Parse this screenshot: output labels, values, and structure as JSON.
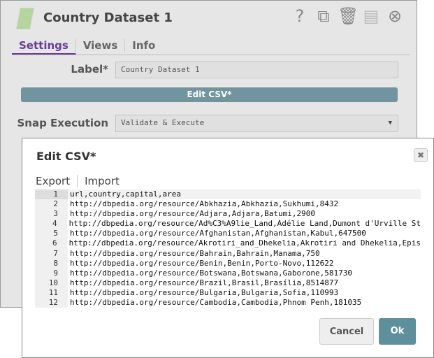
{
  "snap": {
    "title": "Country Dataset 1",
    "icons": [
      "help-icon",
      "export-icon",
      "delete-icon",
      "save-icon",
      "close-icon"
    ],
    "tabs": [
      "Settings",
      "Views",
      "Info"
    ],
    "label_caption": "Label*",
    "label_value": "Country Dataset 1",
    "edit_csv_label": "Edit CSV*",
    "execution_caption": "Snap Execution",
    "execution_value": "Validate & Execute"
  },
  "modal": {
    "title": "Edit CSV*",
    "export_label": "Export",
    "import_label": "Import",
    "lines": [
      {
        "n": "1",
        "text": "url,country,capital,area"
      },
      {
        "n": "2",
        "text": "http://dbpedia.org/resource/Abkhazia,Abkhazia,Sukhumi,8432"
      },
      {
        "n": "3",
        "text": "http://dbpedia.org/resource/Adjara,Adjara,Batumi,2900"
      },
      {
        "n": "4",
        "text": "http://dbpedia.org/resource/Ad%C3%A9lie_Land,Adélie Land,Dumont d'Urville St"
      },
      {
        "n": "5",
        "text": "http://dbpedia.org/resource/Afghanistan,Afghanistan,Kabul,647500"
      },
      {
        "n": "6",
        "text": "http://dbpedia.org/resource/Akrotiri_and_Dhekelia,Akrotiri and Dhekelia,Epis"
      },
      {
        "n": "7",
        "text": "http://dbpedia.org/resource/Bahrain,Bahrain,Manama,750"
      },
      {
        "n": "8",
        "text": "http://dbpedia.org/resource/Benin,Benin,Porto-Novo,112622"
      },
      {
        "n": "9",
        "text": "http://dbpedia.org/resource/Botswana,Botswana,Gaborone,581730"
      },
      {
        "n": "10",
        "text": "http://dbpedia.org/resource/Brazil,Brasil,Brasília,8514877"
      },
      {
        "n": "11",
        "text": "http://dbpedia.org/resource/Bulgaria,Bulgaria,Sofia,110993"
      },
      {
        "n": "12",
        "text": "http://dbpedia.org/resource/Cambodia,Cambodia,Phnom Penh,181035"
      }
    ],
    "cancel_label": "Cancel",
    "ok_label": "Ok"
  },
  "colors": {
    "accent": "#6a3d96",
    "button": "#72949e",
    "ok": "#5e8f9c"
  }
}
